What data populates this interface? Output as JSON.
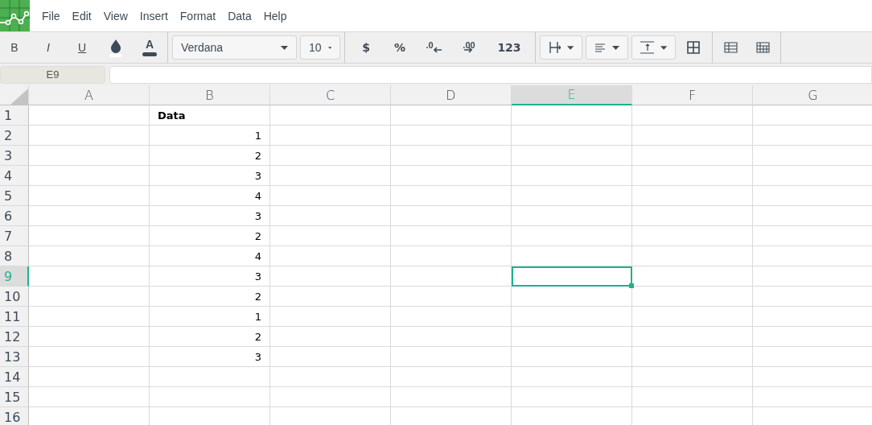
{
  "menu": [
    "File",
    "Edit",
    "View",
    "Insert",
    "Format",
    "Data",
    "Help"
  ],
  "toolbar": {
    "bold": "B",
    "italic": "I",
    "underline": "U",
    "text_color": "A",
    "font": "Verdana",
    "font_size": "10",
    "currency": "$",
    "percent": "%",
    "decrease_decimals": ".0",
    "increase_decimals": ".00",
    "number_format": "123"
  },
  "formula_bar": {
    "cell_name": "E9"
  },
  "columns": [
    {
      "label": "A",
      "selected": false
    },
    {
      "label": "B",
      "selected": false
    },
    {
      "label": "C",
      "selected": false
    },
    {
      "label": "D",
      "selected": false
    },
    {
      "label": "E",
      "selected": true
    },
    {
      "label": "F",
      "selected": false
    },
    {
      "label": "G",
      "selected": false
    }
  ],
  "rows": [
    {
      "label": "1",
      "selected": false,
      "b": {
        "text": "Data",
        "kind": "label"
      }
    },
    {
      "label": "2",
      "selected": false,
      "b": {
        "text": "1",
        "kind": "number"
      }
    },
    {
      "label": "3",
      "selected": false,
      "b": {
        "text": "2",
        "kind": "number"
      }
    },
    {
      "label": "4",
      "selected": false,
      "b": {
        "text": "3",
        "kind": "number"
      }
    },
    {
      "label": "5",
      "selected": false,
      "b": {
        "text": "4",
        "kind": "number"
      }
    },
    {
      "label": "6",
      "selected": false,
      "b": {
        "text": "3",
        "kind": "number"
      }
    },
    {
      "label": "7",
      "selected": false,
      "b": {
        "text": "2",
        "kind": "number"
      }
    },
    {
      "label": "8",
      "selected": false,
      "b": {
        "text": "4",
        "kind": "number"
      }
    },
    {
      "label": "9",
      "selected": true,
      "b": {
        "text": "3",
        "kind": "number"
      }
    },
    {
      "label": "10",
      "selected": false,
      "b": {
        "text": "2",
        "kind": "number"
      }
    },
    {
      "label": "11",
      "selected": false,
      "b": {
        "text": "1",
        "kind": "number"
      }
    },
    {
      "label": "12",
      "selected": false,
      "b": {
        "text": "2",
        "kind": "number"
      }
    },
    {
      "label": "13",
      "selected": false,
      "b": {
        "text": "3",
        "kind": "number"
      }
    },
    {
      "label": "14",
      "selected": false
    },
    {
      "label": "15",
      "selected": false
    },
    {
      "label": "16",
      "selected": false
    }
  ]
}
